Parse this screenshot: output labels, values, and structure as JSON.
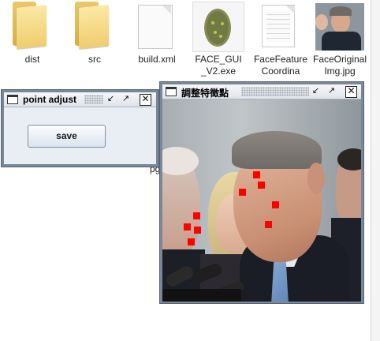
{
  "desktop": {
    "files": [
      {
        "id": "dist",
        "name": "dist",
        "type": "folder"
      },
      {
        "id": "src",
        "name": "src",
        "type": "folder"
      },
      {
        "id": "build",
        "name": "build.xml",
        "type": "file"
      },
      {
        "id": "exe",
        "name": "FACE_GUI_V2.exe",
        "type": "exe"
      },
      {
        "id": "coord",
        "name": "FaceFeatureCoordina",
        "type": "file"
      },
      {
        "id": "orig",
        "name": "FaceOriginalImg.jpg",
        "type": "image"
      }
    ],
    "hidden_label_fragment": "pg"
  },
  "point_adjust_window": {
    "title": "point adjust",
    "save_label": "save"
  },
  "image_window": {
    "title": "調整特徵點",
    "feature_point_color": "#ff0000",
    "feature_point_count": 10
  },
  "colors": {
    "window_border": "#7a8796",
    "folder": "#efcd6d"
  }
}
